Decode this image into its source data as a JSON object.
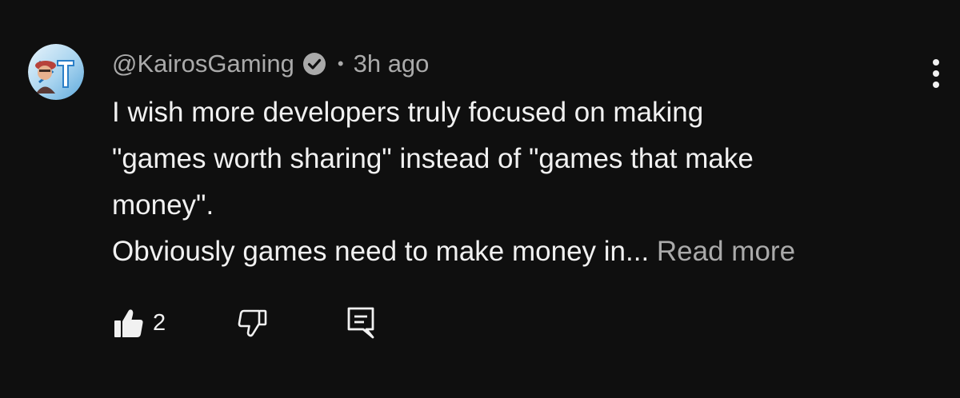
{
  "comment": {
    "author": "@KairosGaming",
    "separator": "•",
    "time": "3h ago",
    "verified_icon": "verified-check-icon",
    "text_lines": [
      "I wish more developers truly focused on making",
      "\"games worth sharing\" instead of \"games that make",
      "money\".",
      "Obviously games need to make money in..."
    ],
    "read_more_label": "Read more",
    "menu_icon": "more-vertical-icon"
  },
  "actions": {
    "like_icon": "thumbs-up-icon",
    "like_count": "2",
    "dislike_icon": "thumbs-down-icon",
    "reply_icon": "reply-comment-icon"
  },
  "colors": {
    "background": "#0f0f0f",
    "text_primary": "#f1f1f1",
    "text_secondary": "#aaaaaa"
  }
}
